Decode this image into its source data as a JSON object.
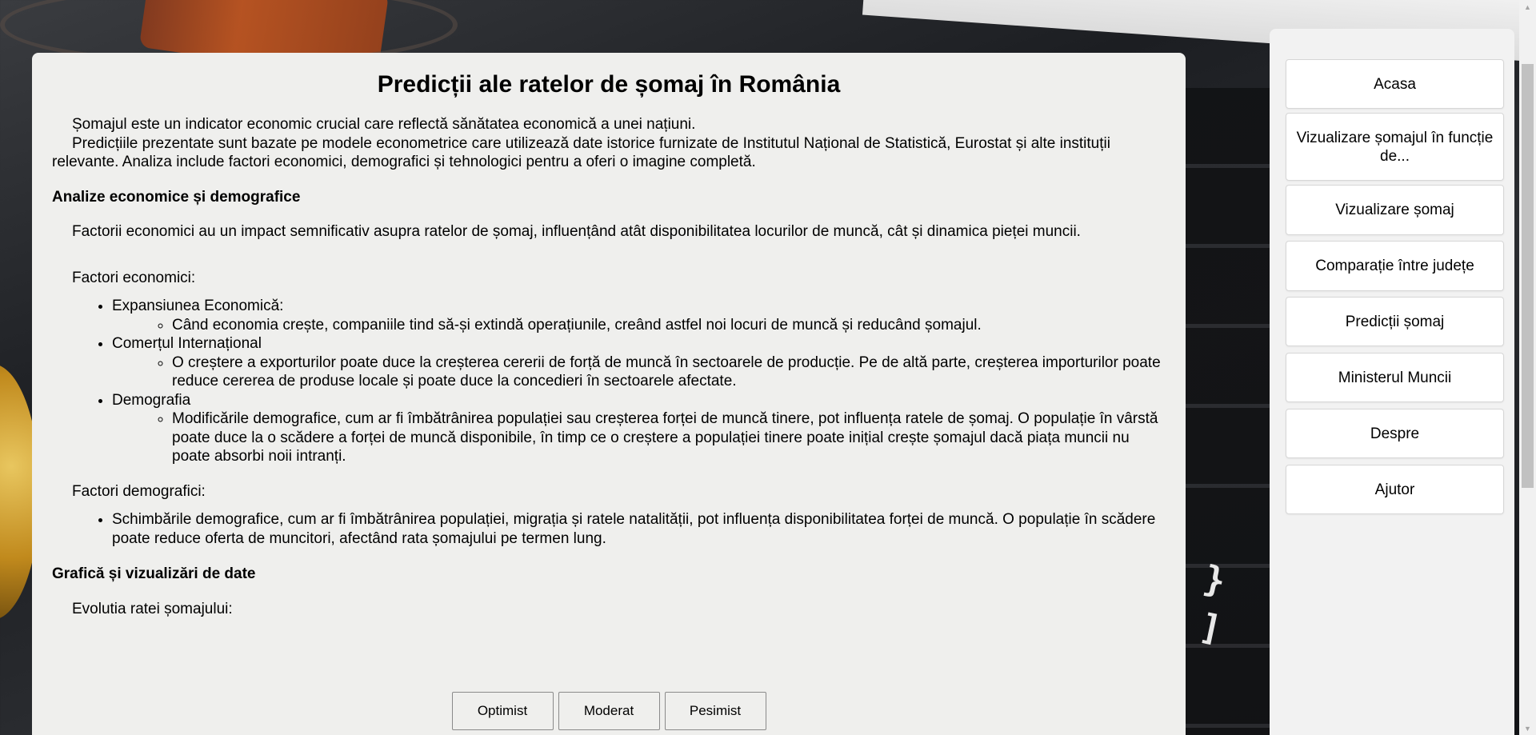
{
  "page": {
    "title": "Predicții ale ratelor de șomaj în România",
    "intro": [
      "Șomajul este un indicator economic crucial care reflectă sănătatea economică a unei națiuni.",
      "Predicțiile prezentate sunt bazate pe modele econometrice care utilizează date istorice furnizate de Institutul Național de Statistică, Eurostat și alte instituții relevante. Analiza include factori economici, demografici și tehnologici pentru a oferi o imagine completă."
    ],
    "section1": {
      "title": "Analize economice și demografice",
      "text": "Factorii economici au un impact semnificativ asupra ratelor de șomaj, influențând atât disponibilitatea locurilor de muncă, cât și dinamica pieței muncii.",
      "economic_heading": "Factori economici:",
      "economic_items": [
        {
          "label": "Expansiunea Economică:",
          "detail": "Când economia crește, companiile tind să-și extindă operațiunile, creând astfel noi locuri de muncă și reducând șomajul."
        },
        {
          "label": "Comerțul Internațional",
          "detail": "O creștere a exporturilor poate duce la creșterea cererii de forță de muncă în sectoarele de producție. Pe de altă parte, creșterea importurilor poate reduce cererea de produse locale și poate duce la concedieri în sectoarele afectate."
        },
        {
          "label": "Demografia",
          "detail": "Modificările demografice, cum ar fi îmbătrânirea populației sau creșterea forței de muncă tinere, pot influența ratele de șomaj. O populație în vârstă poate duce la o scădere a forței de muncă disponibile, în timp ce o creștere a populației tinere poate inițial crește șomajul dacă piața muncii nu poate absorbi noii intranți."
        }
      ],
      "demographic_heading": "Factori demografici:",
      "demographic_items": [
        "Schimbările demografice, cum ar fi îmbătrânirea populației, migrația și ratele natalității, pot influența disponibilitatea forței de muncă. O populație în scădere poate reduce oferta de muncitori, afectând rata șomajului pe termen lung."
      ]
    },
    "section2": {
      "title": "Grafică și vizualizări de date",
      "chart_heading": "Evolutia ratei șomajului:"
    },
    "scenario_buttons": [
      "Optimist",
      "Moderat",
      "Pesimist"
    ]
  },
  "sidebar": {
    "items": [
      "Acasa",
      "Vizualizare șomajul în funcție de...",
      "Vizualizare șomaj",
      "Comparație între județe",
      "Predicții șomaj",
      "Ministerul Muncii",
      "Despre",
      "Ajutor"
    ]
  }
}
